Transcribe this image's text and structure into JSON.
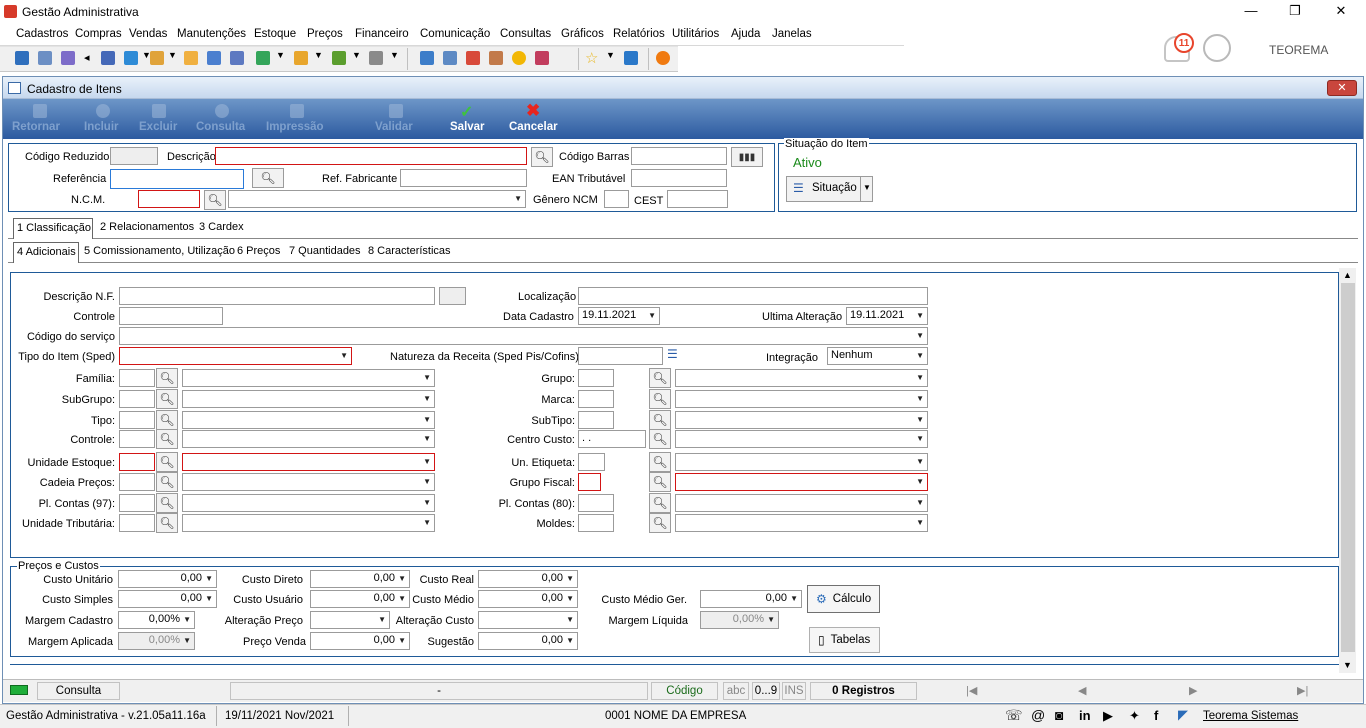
{
  "app": {
    "title": "Gestão Administrativa",
    "brand": "TEOREMA",
    "notif_count": "11"
  },
  "menu": [
    "Cadastros",
    "Compras",
    "Vendas",
    "Manutenções",
    "Estoque",
    "Preços",
    "Financeiro",
    "Comunicação",
    "Consultas",
    "Gráficos",
    "Relatórios",
    "Utilitários",
    "Ajuda",
    "Janelas"
  ],
  "window": {
    "title": "Cadastro de Itens"
  },
  "toolbar": {
    "retornar": "Retornar",
    "incluir": "Incluir",
    "excluir": "Excluir",
    "consulta": "Consulta",
    "impressao": "Impressão",
    "validar": "Validar",
    "salvar": "Salvar",
    "cancelar": "Cancelar"
  },
  "header": {
    "codigo_reduzido": "Código Reduzido",
    "descricao": "Descrição",
    "codigo_barras": "Código Barras",
    "referencia": "Referência",
    "ref_fabricante": "Ref. Fabricante",
    "ean_tributavel": "EAN Tributável",
    "ncm": "N.C.M.",
    "genero_ncm": "Gênero NCM",
    "cest": "CEST"
  },
  "situacao": {
    "legend": "Situação do Item",
    "status": "Ativo",
    "button": "Situação"
  },
  "tabs1": [
    "1 Classificação",
    "2 Relacionamentos",
    "3 Cardex"
  ],
  "tabs2": [
    "4 Adicionais",
    "5 Comissionamento, Utilização",
    "6 Preços",
    "7 Quantidades",
    "8 Características"
  ],
  "form": {
    "descricao_nf": "Descrição N.F.",
    "localizacao": "Localização",
    "controle": "Controle",
    "data_cadastro": "Data Cadastro",
    "data_cadastro_val": "19.11.2021",
    "ultima_alteracao": "Ultima Alteração",
    "ultima_alteracao_val": "19.11.2021",
    "codigo_servico": "Código do serviço",
    "tipo_item": "Tipo do Item (Sped)",
    "natureza_receita": "Natureza da Receita (Sped Pis/Cofins)",
    "integracao": "Integração",
    "integracao_val": "Nenhum",
    "familia": "Família:",
    "subgrupo": "SubGrupo:",
    "tipo": "Tipo:",
    "controle2": "Controle:",
    "unidade_estoque": "Unidade Estoque:",
    "cadeia_precos": "Cadeia Preços:",
    "pl_contas97": "Pl. Contas (97):",
    "unidade_tributaria": "Unidade Tributária:",
    "grupo": "Grupo:",
    "marca": "Marca:",
    "subtipo": "SubTipo:",
    "centro_custo": "Centro Custo:",
    "centro_custo_val": " .  .",
    "un_etiqueta": "Un. Etiqueta:",
    "grupo_fiscal": "Grupo Fiscal:",
    "pl_contas80": "Pl. Contas (80):",
    "moldes": "Moldes:"
  },
  "precos": {
    "legend": "Preços e Custos",
    "custo_unitario": "Custo Unitário",
    "custo_simples": "Custo Simples",
    "margem_cadastro": "Margem Cadastro",
    "margem_aplicada": "Margem Aplicada",
    "custo_direto": "Custo Direto",
    "custo_usuario": "Custo Usuário",
    "alteracao_preco": "Alteração Preço",
    "preco_venda": "Preço Venda",
    "custo_real": "Custo Real",
    "custo_medio": "Custo Médio",
    "alteracao_custo": "Alteração Custo",
    "sugestao": "Sugestão",
    "custo_medio_ger": "Custo Médio Ger.",
    "margem_liquida": "Margem Líquida",
    "zero": "0,00",
    "pct": "0,00%",
    "calculo": "Cálculo",
    "tabelas": "Tabelas"
  },
  "status": {
    "mode": "Consulta",
    "dash": "-",
    "codigo": "Código",
    "abc": "abc",
    "num": "0...9",
    "ins": "INS",
    "registros": "0 Registros"
  },
  "footer": {
    "version": "Gestão Administrativa - v.21.05a11.16a",
    "date": "19/11/2021 Nov/2021",
    "empresa": "0001 NOME DA EMPRESA",
    "link": "Teorema Sistemas"
  }
}
